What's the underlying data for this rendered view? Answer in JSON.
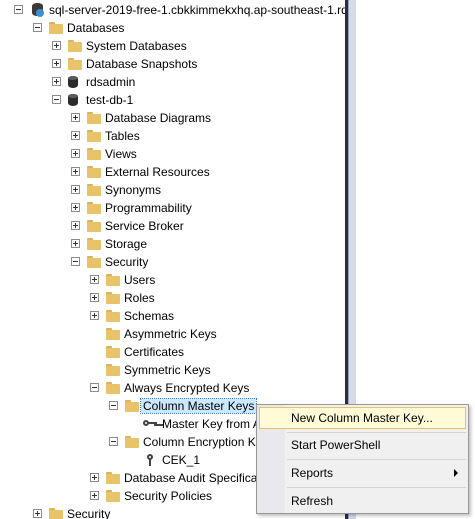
{
  "tree": {
    "server": "sql-server-2019-free-1.cbkkimmekxhq.ap-southeast-1.rds",
    "databases": "Databases",
    "system_databases": "System Databases",
    "database_snapshots": "Database Snapshots",
    "rdsadmin": "rdsadmin",
    "test_db": "test-db-1",
    "database_diagrams": "Database Diagrams",
    "tables": "Tables",
    "views": "Views",
    "external_resources": "External Resources",
    "synonyms": "Synonyms",
    "programmability": "Programmability",
    "service_broker": "Service Broker",
    "storage": "Storage",
    "security_db": "Security",
    "users": "Users",
    "roles": "Roles",
    "schemas": "Schemas",
    "asymmetric_keys": "Asymmetric Keys",
    "certificates": "Certificates",
    "symmetric_keys": "Symmetric Keys",
    "always_encrypted_keys": "Always Encrypted Keys",
    "column_master_keys": "Column Master Keys",
    "master_key_from": "Master Key from A",
    "column_encryption_keys": "Column Encryption K",
    "cek_1": "CEK_1",
    "database_audit": "Database Audit Specifica",
    "security_policies": "Security Policies",
    "security_server": "Security"
  },
  "context_menu": {
    "new_cmk": "New Column Master Key...",
    "start_powershell": "Start PowerShell",
    "reports": "Reports",
    "refresh": "Refresh"
  },
  "colors": {
    "menu_highlight": "#fffbd6",
    "selection": "#cce8ff",
    "folder": "#e8c36a"
  }
}
